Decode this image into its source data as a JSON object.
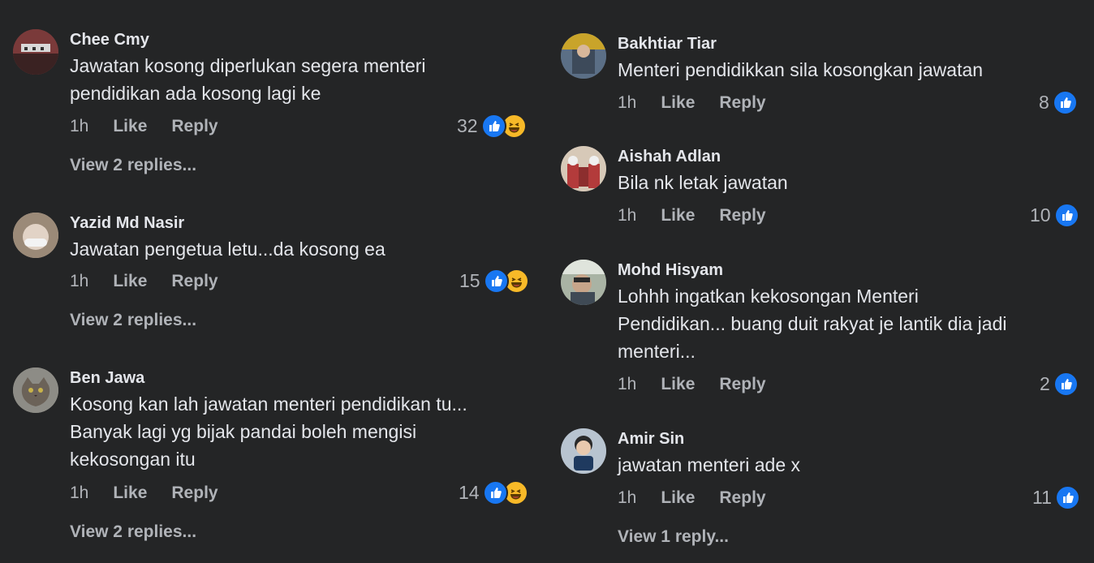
{
  "left_comments": [
    {
      "author": "Chee Cmy",
      "text_lines": [
        "Jawatan kosong diperlukan segera menteri",
        "pendidikan ada kosong lagi ke"
      ],
      "time": "1h",
      "like": "Like",
      "reply": "Reply",
      "reaction_count": "32",
      "reactions": [
        "like-icon",
        "haha-icon"
      ],
      "view_replies": "View 2 replies...",
      "avatar_color": "#7a3a3a"
    },
    {
      "author": "Yazid Md Nasir",
      "text_lines": [
        "Jawatan pengetua letu...da kosong ea"
      ],
      "time": "1h",
      "like": "Like",
      "reply": "Reply",
      "reaction_count": "15",
      "reactions": [
        "like-icon",
        "haha-icon"
      ],
      "view_replies": "View 2 replies...",
      "avatar_color": "#c9b7a4"
    },
    {
      "author": "Ben Jawa",
      "text_lines": [
        "Kosong kan lah jawatan menteri pendidikan tu...",
        "Banyak lagi yg bijak pandai boleh mengisi",
        "kekosongan itu"
      ],
      "time": "1h",
      "like": "Like",
      "reply": "Reply",
      "reaction_count": "14",
      "reactions": [
        "like-icon",
        "haha-icon"
      ],
      "view_replies": "View 2 replies...",
      "avatar_color": "#8a8a82"
    }
  ],
  "right_comments": [
    {
      "author": "Bakhtiar Tiar",
      "text_lines": [
        "Menteri pendidikkan sila kosongkan jawatan"
      ],
      "time": "1h",
      "like": "Like",
      "reply": "Reply",
      "reaction_count": "8",
      "reactions": [
        "like-icon"
      ],
      "avatar_color": "#c9a42a"
    },
    {
      "author": "Aishah Adlan",
      "text_lines": [
        "Bila nk letak jawatan"
      ],
      "time": "1h",
      "like": "Like",
      "reply": "Reply",
      "reaction_count": "10",
      "reactions": [
        "like-icon"
      ],
      "avatar_color": "#b33b3b"
    },
    {
      "author": "Mohd Hisyam",
      "text_lines": [
        "Lohhh ingatkan kekosongan Menteri",
        "Pendidikan... buang duit rakyat je lantik dia jadi",
        "menteri..."
      ],
      "time": "1h",
      "like": "Like",
      "reply": "Reply",
      "reaction_count": "2",
      "reactions": [
        "like-icon"
      ],
      "avatar_color": "#6f7a6a"
    },
    {
      "author": "Amir Sin",
      "text_lines": [
        "jawatan menteri ade x"
      ],
      "time": "1h",
      "like": "Like",
      "reply": "Reply",
      "reaction_count": "11",
      "reactions": [
        "like-icon"
      ],
      "view_replies": "View 1 reply...",
      "avatar_color": "#3a4a6a"
    }
  ],
  "colors": {
    "background": "#242526",
    "primary_text": "#e4e6eb",
    "secondary_text": "#b0b3b8",
    "like_blue": "#1877f2",
    "haha_yellow": "#f7b928"
  }
}
